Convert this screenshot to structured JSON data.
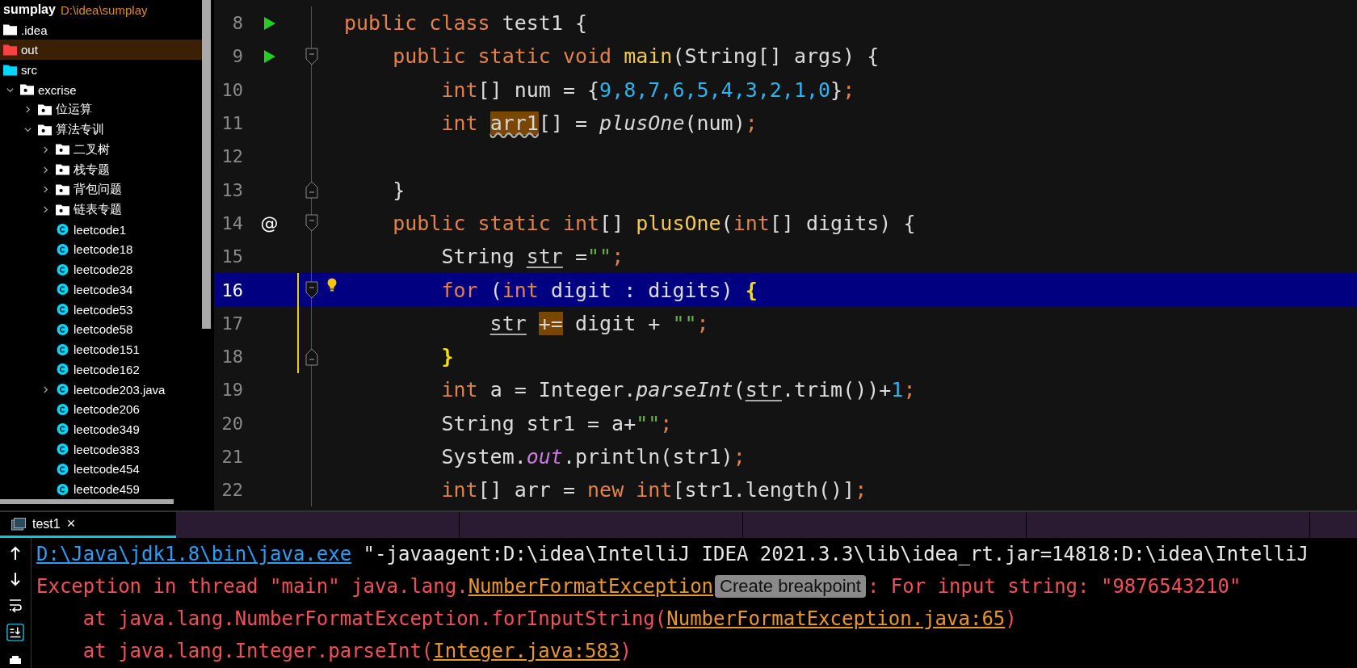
{
  "project": {
    "name": "sumplay",
    "path": "D:\\idea\\sumplay"
  },
  "tree": [
    {
      "label": ".idea",
      "kind": "folder",
      "color": "#ffffff",
      "selected": false
    },
    {
      "label": "out",
      "kind": "folder",
      "color": "#ff4040",
      "selected": true
    },
    {
      "label": "src",
      "kind": "folder",
      "color": "#00d8ff",
      "selected": false
    },
    {
      "label": "excrise",
      "kind": "package",
      "expanded": true,
      "selected": false,
      "children": [
        {
          "label": "位运算",
          "kind": "package",
          "expanded": false,
          "selected": false
        },
        {
          "label": "算法专训",
          "kind": "package",
          "expanded": true,
          "selected": false,
          "children": [
            {
              "label": "二叉树",
              "kind": "package",
              "expanded": false,
              "selected": false
            },
            {
              "label": "栈专题",
              "kind": "package",
              "expanded": false,
              "selected": false
            },
            {
              "label": "背包问题",
              "kind": "package",
              "expanded": false,
              "selected": false
            },
            {
              "label": "链表专题",
              "kind": "package",
              "expanded": false,
              "selected": false
            },
            {
              "label": "leetcode1",
              "kind": "class",
              "selected": false
            },
            {
              "label": "leetcode18",
              "kind": "class",
              "selected": false
            },
            {
              "label": "leetcode28",
              "kind": "class",
              "selected": false
            },
            {
              "label": "leetcode34",
              "kind": "class",
              "selected": false
            },
            {
              "label": "leetcode53",
              "kind": "class",
              "selected": false
            },
            {
              "label": "leetcode58",
              "kind": "class",
              "selected": false
            },
            {
              "label": "leetcode151",
              "kind": "class",
              "selected": false
            },
            {
              "label": "leetcode162",
              "kind": "class",
              "selected": false
            },
            {
              "label": "leetcode203.java",
              "kind": "class",
              "expanded": false,
              "selected": false
            },
            {
              "label": "leetcode206",
              "kind": "class",
              "selected": false
            },
            {
              "label": "leetcode349",
              "kind": "class",
              "selected": false
            },
            {
              "label": "leetcode383",
              "kind": "class",
              "selected": false
            },
            {
              "label": "leetcode454",
              "kind": "class",
              "selected": false
            },
            {
              "label": "leetcode459",
              "kind": "class",
              "selected": false
            }
          ]
        }
      ]
    }
  ],
  "editor": {
    "lines": [
      {
        "number": "8",
        "runnable": true,
        "selected": false,
        "tokens": [
          {
            "kind": "kw",
            "text": "public class "
          },
          {
            "kind": "txt",
            "text": "test1 {"
          }
        ],
        "children": [
          {
            "number": "9",
            "runnable": true,
            "fold_start": true,
            "selected": false,
            "tokens": [
              {
                "kind": "kw",
                "text": "public static void "
              },
              {
                "kind": "decl",
                "text": "main"
              },
              {
                "kind": "txt",
                "text": "(String[] args) {"
              }
            ],
            "children": [
              {
                "number": "10",
                "selected": false,
                "tokens": [
                  {
                    "kind": "kw",
                    "text": "int"
                  },
                  {
                    "kind": "txt",
                    "text": "[] num = {"
                  },
                  {
                    "kind": "num",
                    "text": "9,8,7,6,5,4,3,2,1,0"
                  },
                  {
                    "kind": "txt",
                    "text": "}"
                  },
                  {
                    "kind": "semi",
                    "text": ";"
                  }
                ]
              },
              {
                "number": "11",
                "selected": false,
                "tokens": [
                  {
                    "kind": "kw",
                    "text": "int "
                  },
                  {
                    "kind": "warn",
                    "text": "arr1"
                  },
                  {
                    "kind": "txt",
                    "text": "[] = "
                  },
                  {
                    "kind": "call",
                    "text": "plusOne"
                  },
                  {
                    "kind": "txt",
                    "text": "(num)"
                  },
                  {
                    "kind": "semi",
                    "text": ";"
                  }
                ]
              },
              {
                "number": "12",
                "selected": false
              }
            ]
          },
          {
            "number": "13",
            "fold_end": true,
            "selected": false,
            "tokens": [
              {
                "kind": "txt",
                "text": "}"
              }
            ]
          },
          {
            "number": "14",
            "gutter_text": "@",
            "fold_start": true,
            "selected": false,
            "tokens": [
              {
                "kind": "kw",
                "text": "public static int"
              },
              {
                "kind": "txt",
                "text": "[] "
              },
              {
                "kind": "decl",
                "text": "plusOne"
              },
              {
                "kind": "txt",
                "text": "("
              },
              {
                "kind": "kw",
                "text": "int"
              },
              {
                "kind": "txt",
                "text": "[] digits) {"
              }
            ],
            "children": [
              {
                "number": "15",
                "selected": false,
                "tokens": [
                  {
                    "kind": "txt",
                    "text": "String "
                  },
                  {
                    "kind": "var",
                    "text": "str"
                  },
                  {
                    "kind": "txt",
                    "text": " ="
                  },
                  {
                    "kind": "str",
                    "text": "\"\""
                  },
                  {
                    "kind": "semi",
                    "text": ";"
                  }
                ]
              },
              {
                "number": "16",
                "fold_start": true,
                "bulb": true,
                "changed": true,
                "selected": true,
                "tokens": [
                  {
                    "kind": "kw",
                    "text": "for "
                  },
                  {
                    "kind": "txt",
                    "text": "("
                  },
                  {
                    "kind": "kw",
                    "text": "int "
                  },
                  {
                    "kind": "txt",
                    "text": "digit : digits) "
                  },
                  {
                    "kind": "brace",
                    "text": "{"
                  }
                ],
                "children": [
                  {
                    "number": "17",
                    "changed": true,
                    "selected": false,
                    "tokens": [
                      {
                        "kind": "var",
                        "text": "str"
                      },
                      {
                        "kind": "ophl",
                        "text": "+="
                      },
                      {
                        "kind": "txt",
                        "text": " digit + "
                      },
                      {
                        "kind": "str",
                        "text": "\"\""
                      },
                      {
                        "kind": "semi",
                        "text": ";"
                      }
                    ]
                  }
                ]
              },
              {
                "number": "18",
                "fold_end": true,
                "changed": true,
                "selected": false,
                "tokens": [
                  {
                    "kind": "brace",
                    "text": "}"
                  }
                ]
              },
              {
                "number": "19",
                "selected": false,
                "tokens": [
                  {
                    "kind": "kw",
                    "text": "int "
                  },
                  {
                    "kind": "txt",
                    "text": "a = Integer."
                  },
                  {
                    "kind": "call",
                    "text": "parseInt"
                  },
                  {
                    "kind": "txt",
                    "text": "("
                  },
                  {
                    "kind": "var",
                    "text": "str"
                  },
                  {
                    "kind": "txt",
                    "text": ".trim())+"
                  },
                  {
                    "kind": "num",
                    "text": "1"
                  },
                  {
                    "kind": "semi",
                    "text": ";"
                  }
                ]
              },
              {
                "number": "20",
                "selected": false,
                "tokens": [
                  {
                    "kind": "txt",
                    "text": "String str1 = a+"
                  },
                  {
                    "kind": "str",
                    "text": "\"\""
                  },
                  {
                    "kind": "semi",
                    "text": ";"
                  }
                ]
              },
              {
                "number": "21",
                "selected": false,
                "tokens": [
                  {
                    "kind": "txt",
                    "text": "System."
                  },
                  {
                    "kind": "field",
                    "text": "out"
                  },
                  {
                    "kind": "txt",
                    "text": ".println(str1)"
                  },
                  {
                    "kind": "semi",
                    "text": ";"
                  }
                ]
              },
              {
                "number": "22",
                "selected": false,
                "tokens": [
                  {
                    "kind": "kw",
                    "text": "int"
                  },
                  {
                    "kind": "txt",
                    "text": "[] arr = "
                  },
                  {
                    "kind": "kw",
                    "text": "new int"
                  },
                  {
                    "kind": "txt",
                    "text": "[str1.length()]"
                  },
                  {
                    "kind": "semi",
                    "text": ";"
                  }
                ]
              }
            ]
          }
        ]
      }
    ]
  },
  "console": {
    "tabs": [
      {
        "label": "test1",
        "close": "×",
        "selected": true
      }
    ],
    "lines": [
      {
        "segments": [
          {
            "kind": "path-link",
            "text": "D:\\Java\\jdk1.8\\bin\\java.exe"
          },
          {
            "kind": "text",
            "text": " \"-javaagent:D:\\idea\\IntelliJ IDEA 2021.3.3\\lib\\idea_rt.jar=14818:D:\\idea\\IntelliJ"
          }
        ]
      },
      {
        "segments": [
          {
            "kind": "error",
            "text": "Exception in thread \"main\" java.lang."
          },
          {
            "kind": "error-link",
            "text": "NumberFormatException"
          },
          {
            "kind": "tooltip",
            "text": "Create breakpoint"
          },
          {
            "kind": "error",
            "text": ": For input string: \"9876543210\""
          }
        ]
      },
      {
        "children": [
          {
            "segments": [
              {
                "kind": "error",
                "text": "at java.lang.NumberFormatException.forInputString("
              },
              {
                "kind": "error-link",
                "text": "NumberFormatException.java:65"
              },
              {
                "kind": "error",
                "text": ")"
              }
            ]
          },
          {
            "segments": [
              {
                "kind": "error",
                "text": "at java.lang.Integer.parseInt("
              },
              {
                "kind": "error-link",
                "text": "Integer.java:583"
              },
              {
                "kind": "error",
                "text": ")"
              }
            ]
          }
        ]
      }
    ]
  }
}
